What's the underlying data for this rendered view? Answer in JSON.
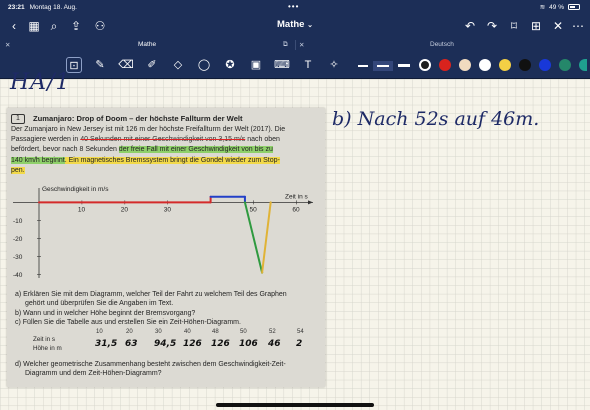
{
  "status": {
    "time": "23:21",
    "date": "Montag 18. Aug.",
    "battery": "49 %"
  },
  "nav": {
    "title": "Mathe"
  },
  "tabs": [
    {
      "label": "Mathe"
    },
    {
      "label": "Deutsch"
    }
  ],
  "toolbar": {
    "colors": [
      "#1e1e1e",
      "#d9231d",
      "#f0dbc0",
      "#ffffff",
      "#f3cf45",
      "#111111",
      "#1838d8",
      "#25876a"
    ]
  },
  "ink": {
    "top_left": "HA/1",
    "answer_b": "b) Nach 52s auf 46m."
  },
  "sheet": {
    "number": "1",
    "title": "Zumanjaro: Drop of Doom – der höchste Fallturm der Welt",
    "p1": "Der Zumanjaro in New Jersey ist mit 126 m der höchste Freifallturm der Welt (2017). Die",
    "p2a": "Passagiere werden in ",
    "p2b": "40 Sekunden mit einer Geschwindigkeit von 3,15 m/s",
    "p2c": " nach oben",
    "p3a": "befördert, bevor nach 8 Sekunden ",
    "p3b": "der freie Fall mit einer Geschwindigkeit von bis zu",
    "p4a": "140 km/h beginnt",
    "p4b": ". Ein magnetisches Bremssystem bringt die Gondel wieder zum Stop-",
    "p5": "pen.",
    "qa": "a)  Erklären Sie mit dem Diagramm, welcher Teil der Fahrt zu welchem Teil des Graphen",
    "qa2": "gehört und überprüfen Sie die Angaben im Text.",
    "qb": "b)  Wann und in welcher Höhe beginnt der Bremsvorgang?",
    "qc": "c)  Füllen Sie die Tabelle aus und erstellen Sie ein Zeit-Höhen-Diagramm.",
    "row1_label": "Zeit in s",
    "row2_label": "Höhe in m",
    "times": [
      "10",
      "20",
      "30",
      "40",
      "48",
      "50",
      "52",
      "54"
    ],
    "heights": [
      "31,5",
      "63",
      "94,5",
      "126",
      "126",
      "106",
      "46",
      "2"
    ],
    "qd": "d)  Welcher geometrische Zusammenhang besteht zwischen dem Geschwindigkeit-Zeit-",
    "qd2": "Diagramm und dem Zeit-Höhen-Diagramm?"
  },
  "chart_data": {
    "type": "line",
    "ylabel": "Geschwindigkeit in m/s",
    "xlabel": "Zeit in s",
    "xlim": [
      0,
      62
    ],
    "ylim": [
      -42,
      8
    ],
    "x_ticks": [
      "10",
      "20",
      "30",
      "50",
      "60"
    ],
    "y_ticks": [
      "-10",
      "-20",
      "-30",
      "-40"
    ],
    "series": [
      {
        "x": [
          0,
          40,
          40,
          48,
          48,
          52,
          52,
          54,
          54
        ],
        "y": [
          0,
          0,
          3.15,
          3.15,
          0,
          -39,
          -39,
          0,
          0
        ]
      }
    ]
  }
}
